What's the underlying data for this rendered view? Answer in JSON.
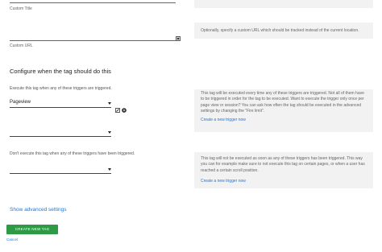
{
  "custom_title": {
    "label": "Custom Title",
    "value": ""
  },
  "custom_url": {
    "label": "Custom URL",
    "value": "",
    "help": "Optionally, specify a custom URL which should be tracked instead of the current location."
  },
  "section": {
    "heading": "Configure when the tag should do this"
  },
  "fire_triggers": {
    "label": "Execute this tag when any of these triggers are triggered.",
    "selects": [
      {
        "value": "Pageview"
      },
      {
        "value": ""
      }
    ],
    "help": "This tag will be executed every time any of these triggers are triggered. Not all of them have to be triggered in order for the tag to be executed. Want to execute the trigger only once per page view or session? You can ask how often the tag should be executed in the advanced settings by changing the \"Fire limit\".",
    "create_link": "Create a new trigger now"
  },
  "block_triggers": {
    "label": "Don't execute this tag when any of these triggers have been triggered.",
    "selects": [
      {
        "value": ""
      }
    ],
    "help": "This tag will not be executed as soon as any of these triggers has been triggered. This way you can for example make sure to not execute this tag on certain pages, or when a user has reached a certain scroll position.",
    "create_link": "Create a new trigger now"
  },
  "advanced": {
    "label": "Show advanced settings"
  },
  "actions": {
    "create_label": "CREATE NEW TAG",
    "cancel_label": "Cancel"
  }
}
